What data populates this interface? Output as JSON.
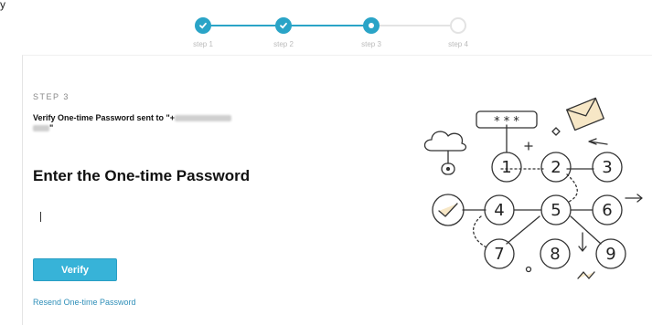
{
  "corner_mark": "y",
  "stepper": {
    "steps": [
      {
        "label": "step 1",
        "state": "done"
      },
      {
        "label": "step 2",
        "state": "done"
      },
      {
        "label": "step 3",
        "state": "current"
      },
      {
        "label": "step 4",
        "state": "pending"
      }
    ]
  },
  "main": {
    "step_caption": "STEP 3",
    "subtitle_prefix": "Verify One-time Password sent to \"+",
    "subtitle_suffix": "\"",
    "heading": "Enter the One-time Password",
    "otp_input_value": "",
    "verify_label": "Verify",
    "resend_label": "Resend One-time Password"
  },
  "illustration": {
    "password_field": "* * *",
    "numbers": [
      "1",
      "2",
      "3",
      "4",
      "5",
      "6",
      "7",
      "8",
      "9"
    ]
  },
  "colors": {
    "accent": "#2aa4c7",
    "button": "#37b3d8",
    "link": "#2f8fb9"
  }
}
